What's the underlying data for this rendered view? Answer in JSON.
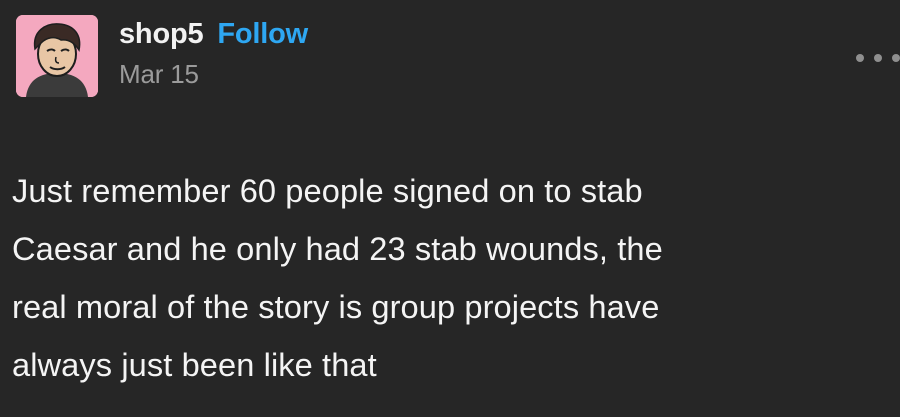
{
  "post": {
    "username": "shop5",
    "follow_label": "Follow",
    "date": "Mar 15",
    "more_icon": "more-horizontal-icon",
    "avatar_icon": "avatar-illustration",
    "body_lines": [
      "Just remember 60 people signed on to stab",
      "Caesar and he only had 23 stab wounds, the",
      "real moral of the story is group projects have",
      "always just been like that"
    ]
  },
  "colors": {
    "background": "#262626",
    "username": "#f2f2f2",
    "follow": "#2ea7f2",
    "date": "#9b9b9b",
    "avatar_bg": "#f4a8bf"
  }
}
